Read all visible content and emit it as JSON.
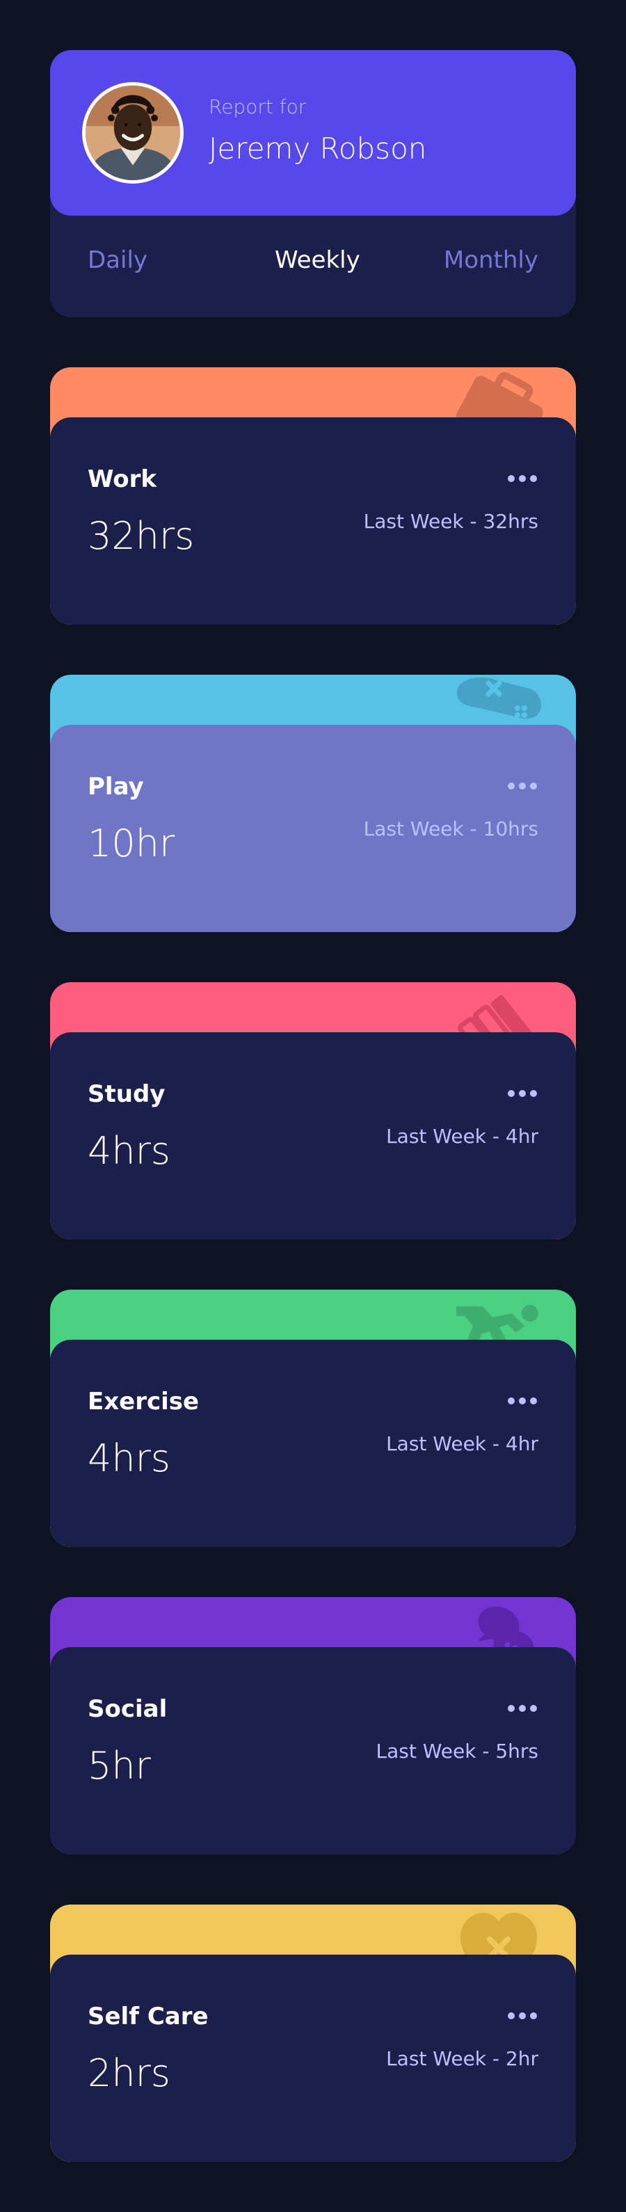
{
  "profile": {
    "report_label": "Report for",
    "name": "Jeremy Robson",
    "avatar_icon": "profile-photo"
  },
  "periods": [
    {
      "label": "Daily",
      "active": false
    },
    {
      "label": "Weekly",
      "active": true
    },
    {
      "label": "Monthly",
      "active": false
    }
  ],
  "activities": [
    {
      "title": "Work",
      "current": "32hrs",
      "previous": "Last Week - 32hrs",
      "color": "#ff8b64",
      "icon": "briefcase-icon"
    },
    {
      "title": "Play",
      "current": "10hr",
      "previous": "Last Week - 10hrs",
      "color": "#55c2e6",
      "icon": "gamepad-icon"
    },
    {
      "title": "Study",
      "current": "4hrs",
      "previous": "Last Week - 4hr",
      "color": "#ff5e7d",
      "icon": "books-icon"
    },
    {
      "title": "Exercise",
      "current": "4hrs",
      "previous": "Last Week - 4hr",
      "color": "#4bcf82",
      "icon": "running-icon"
    },
    {
      "title": "Social",
      "current": "5hr",
      "previous": "Last Week - 5hrs",
      "color": "#7335d2",
      "icon": "chat-bubbles-icon"
    },
    {
      "title": "Self Care",
      "current": "2hrs",
      "previous": "Last Week - 2hr",
      "color": "#f1c75b",
      "icon": "heart-icon"
    }
  ],
  "colors": {
    "background": "#0e1323",
    "card": "#1c1f4a",
    "card_highlight": "#6f76c8",
    "profile_accent": "#5847eb",
    "muted_text": "#bbc0ff",
    "inactive_period": "#7279d8"
  }
}
